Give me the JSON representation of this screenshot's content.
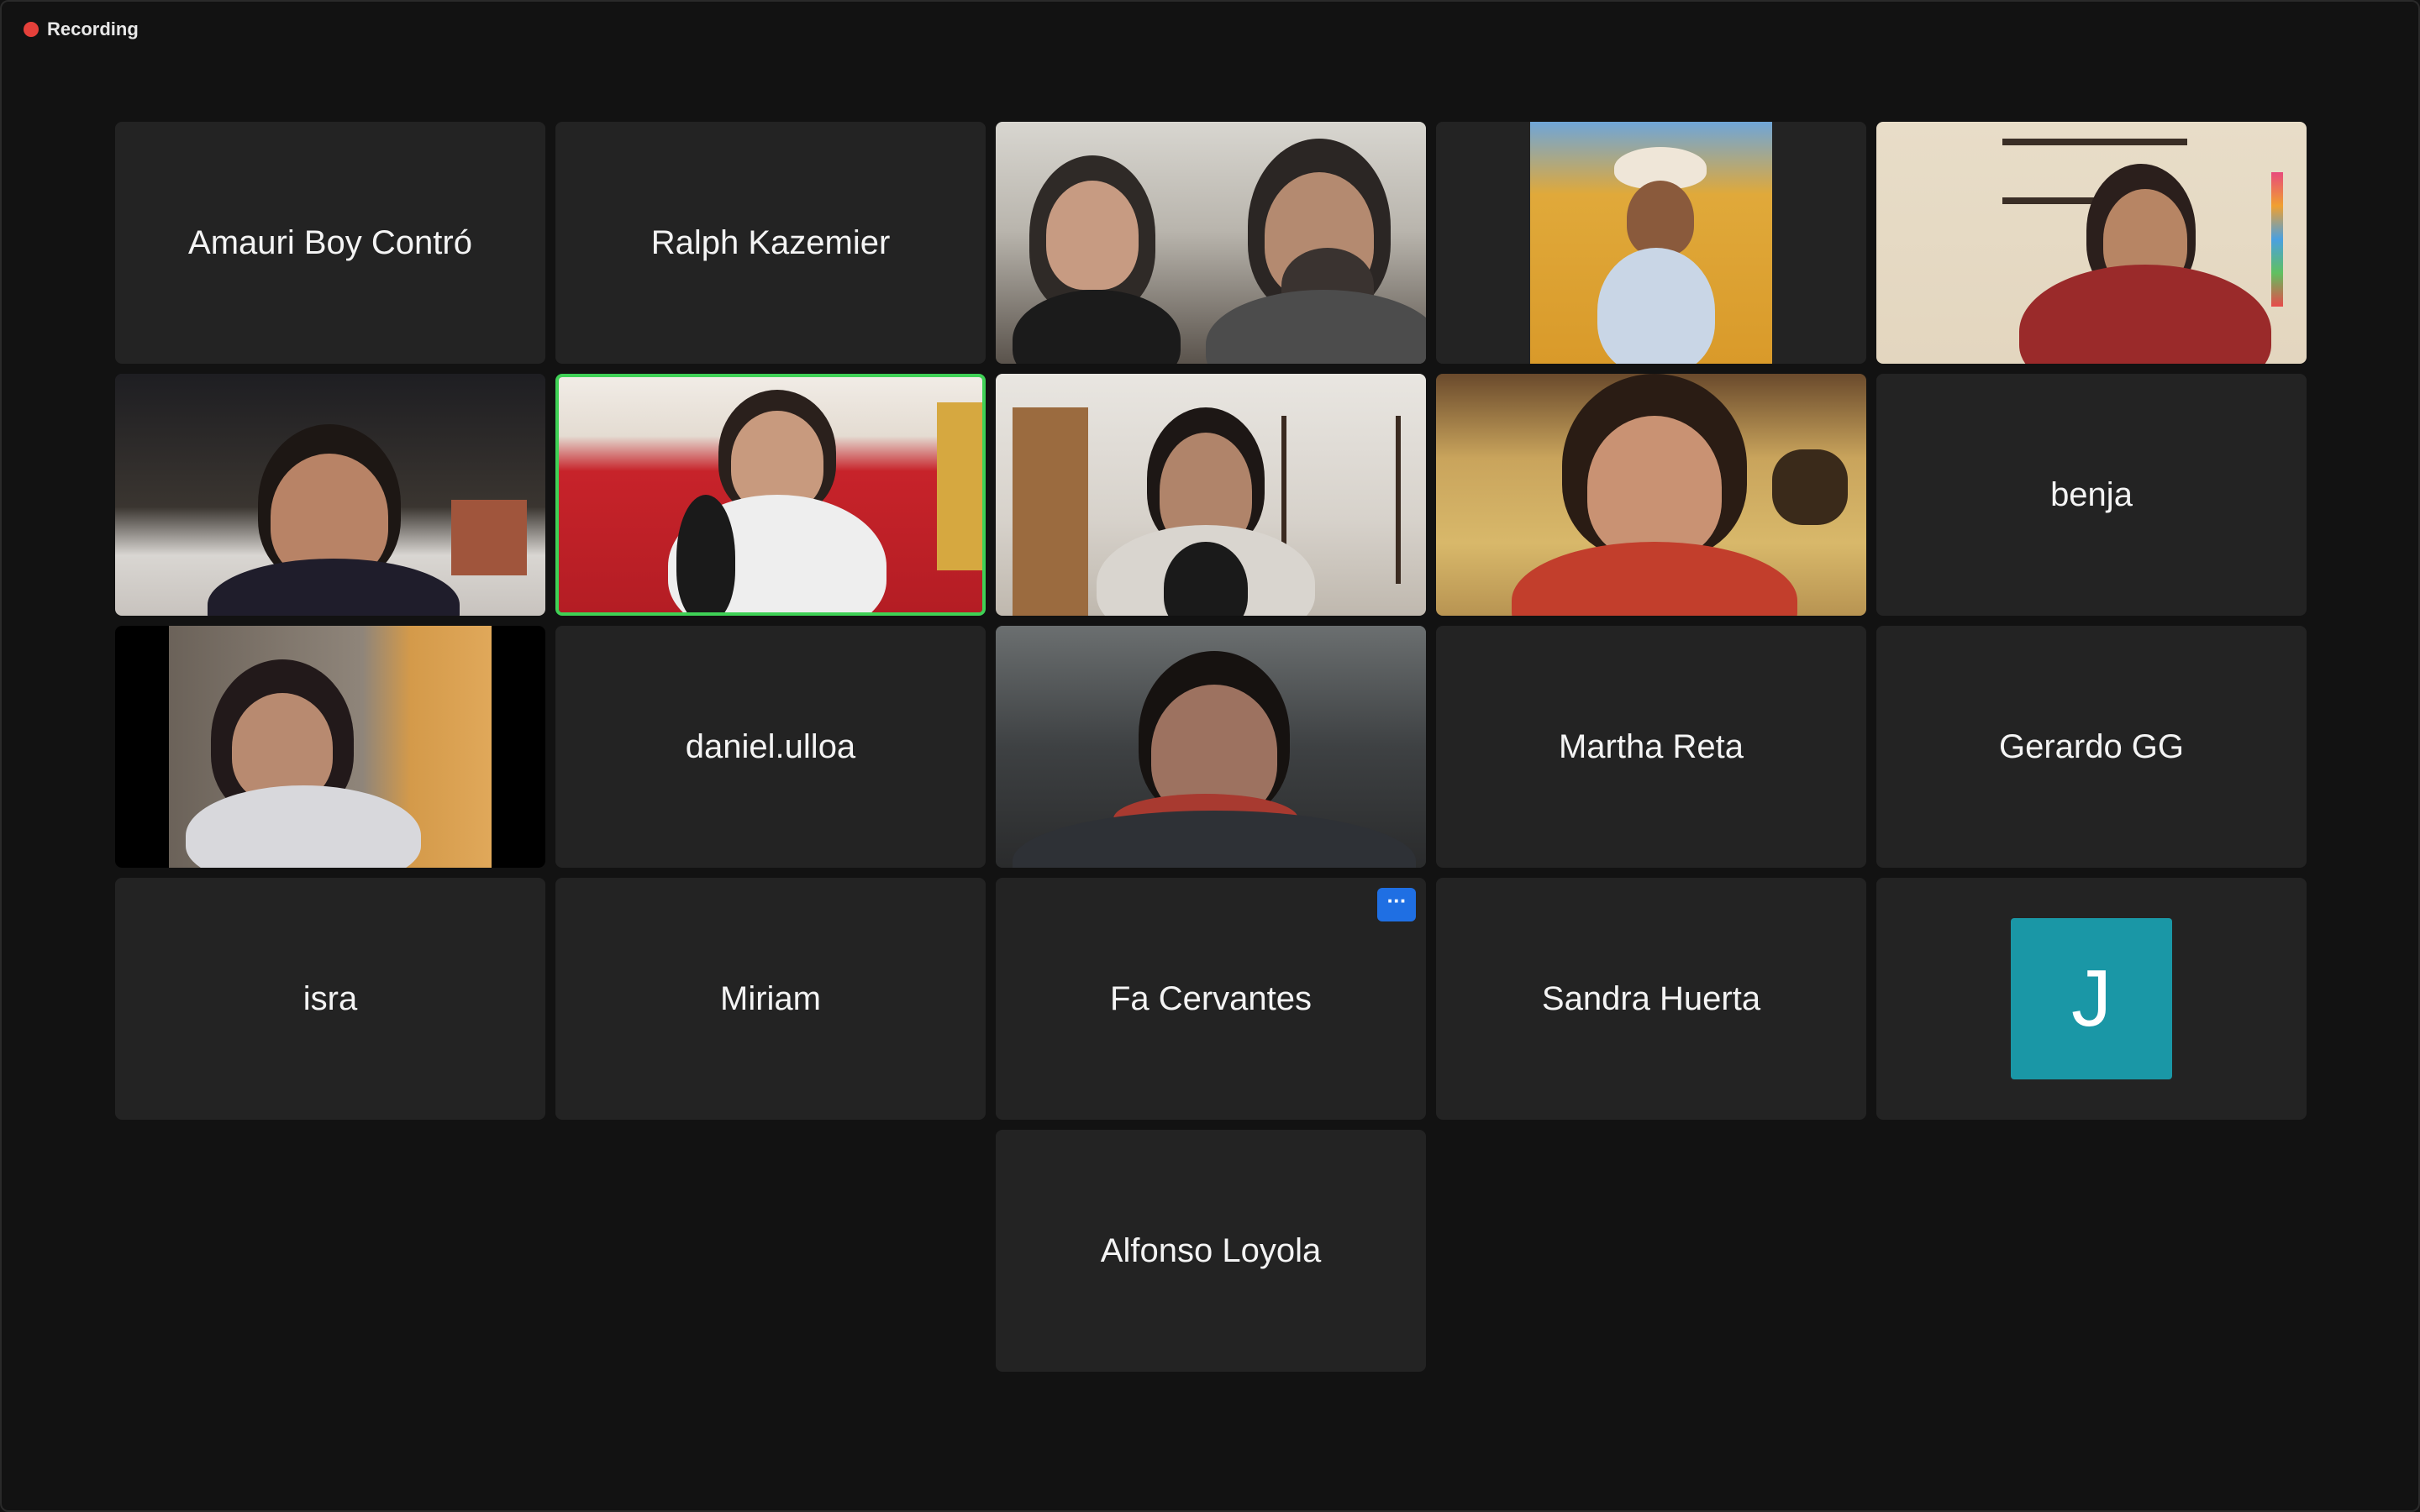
{
  "recording": {
    "label": "Recording",
    "color": "#e5403a"
  },
  "active_speaker_border_color": "#3fd156",
  "tiles": [
    {
      "name": "Amauri Boy Contró",
      "has_video": false
    },
    {
      "name": "Ralph Kazemier",
      "has_video": false
    },
    {
      "name": "",
      "has_video": true,
      "thumbnail": "two-people-video"
    },
    {
      "name": "",
      "has_video": true,
      "thumbnail": "cowboy-hat-man-video"
    },
    {
      "name": "",
      "has_video": true,
      "thumbnail": "woman-red-sweater-video"
    },
    {
      "name": "",
      "has_video": true,
      "thumbnail": "man-glasses-video"
    },
    {
      "name": "",
      "has_video": true,
      "thumbnail": "woman-headphones-red-couch-video",
      "active_speaker": true
    },
    {
      "name": "",
      "has_video": true,
      "thumbnail": "bearded-man-sweater-video"
    },
    {
      "name": "",
      "has_video": true,
      "thumbnail": "curly-hair-man-video"
    },
    {
      "name": "benja",
      "has_video": false
    },
    {
      "name": "",
      "has_video": true,
      "thumbnail": "woman-reading-video"
    },
    {
      "name": "daniel.ulloa",
      "has_video": false
    },
    {
      "name": "",
      "has_video": true,
      "thumbnail": "man-glasses-dark-video"
    },
    {
      "name": "Martha Reta",
      "has_video": false
    },
    {
      "name": "Gerardo GG",
      "has_video": false
    },
    {
      "name": "isra",
      "has_video": false
    },
    {
      "name": "Miriam",
      "has_video": false
    },
    {
      "name": "Fa Cervantes",
      "has_video": false,
      "more_button": true
    },
    {
      "name": "Sandra Huerta",
      "has_video": false
    },
    {
      "name": "",
      "has_video": false,
      "avatar_letter": "J",
      "avatar_color": "#1a97a6"
    },
    {
      "name": "Alfonso Loyola",
      "has_video": false
    }
  ],
  "more_button_label": "···"
}
